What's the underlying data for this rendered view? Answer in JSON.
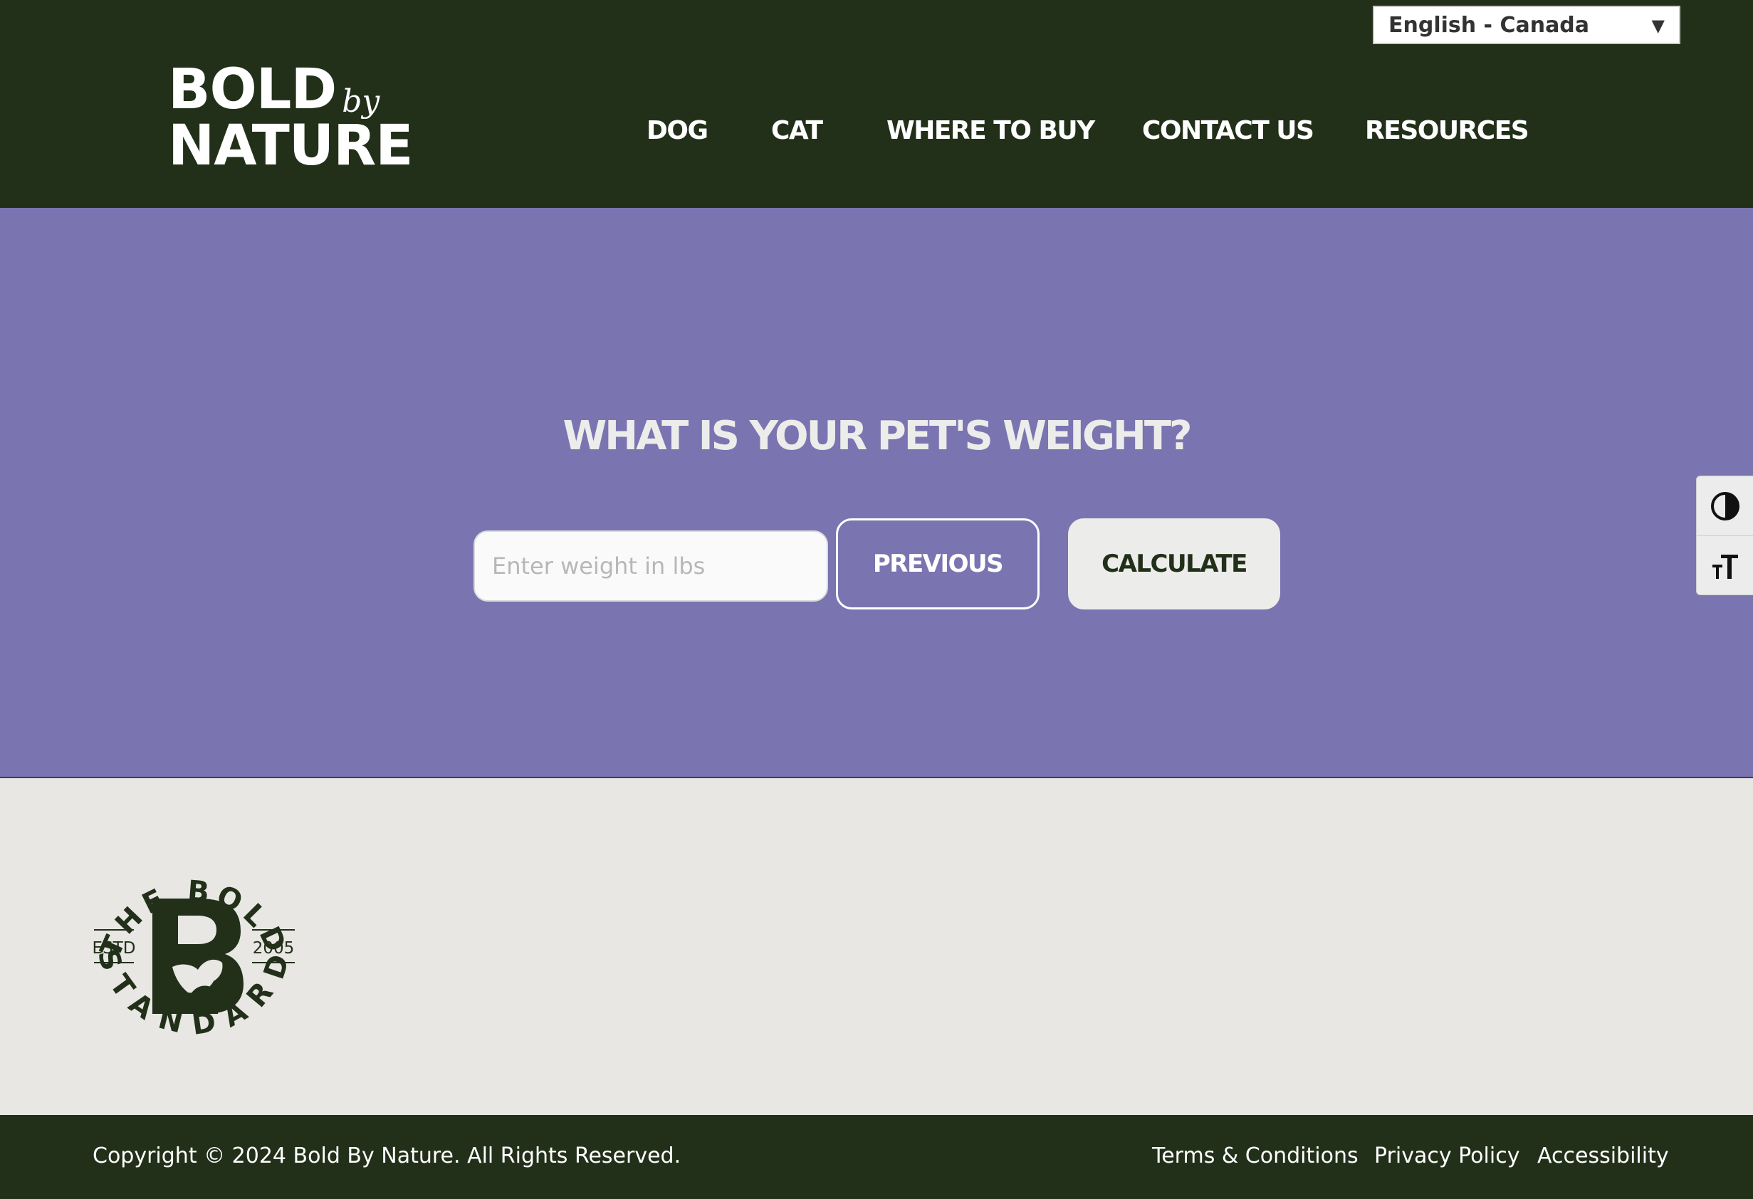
{
  "header": {
    "language_select": {
      "value": "English - Canada",
      "arrow_icon": "caret-down-icon"
    },
    "logo": {
      "line1": "BOLD",
      "by": "by",
      "line2": "NATURE"
    },
    "nav": [
      "DOG",
      "CAT",
      "WHERE TO BUY",
      "CONTACT US",
      "RESOURCES"
    ]
  },
  "hero": {
    "title": "WHAT IS YOUR PET'S WEIGHT?",
    "weight_input": {
      "placeholder": "Enter weight in lbs",
      "value": ""
    },
    "previous_label": "PREVIOUS",
    "calculate_label": "CALCULATE"
  },
  "accessibility_toolbar": {
    "contrast_icon": "contrast-icon",
    "font_size_icon": "text-size-icon"
  },
  "badge": {
    "top_text": "THE BOLD",
    "bottom_text": "STANDARD",
    "left_text": "ESTD",
    "right_text": "2005"
  },
  "footer": {
    "copyright": "Copyright © 2024 Bold By Nature. All Rights Reserved.",
    "links": [
      "Terms & Conditions",
      "Privacy Policy",
      "Accessibility"
    ]
  },
  "colors": {
    "header_bg": "#22301a",
    "hero_bg": "#7a74b1",
    "page_bg": "#e8e7e3",
    "title_text": "#ececea"
  }
}
